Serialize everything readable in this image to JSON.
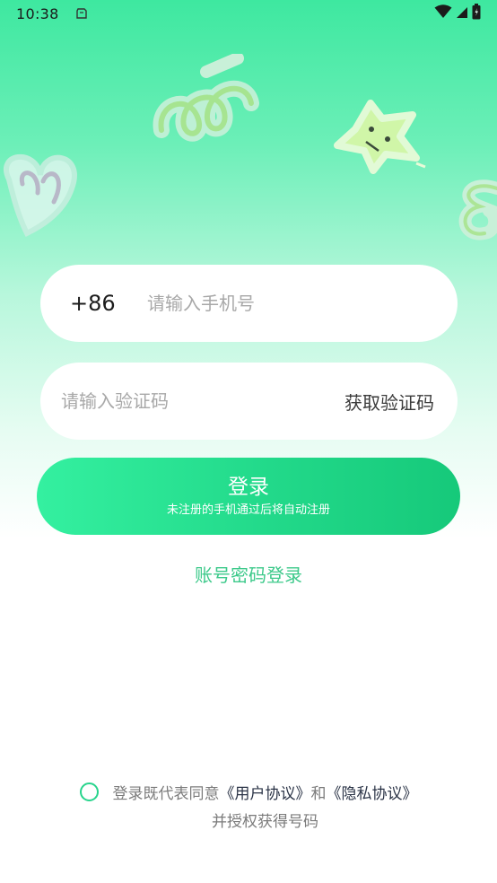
{
  "status_bar": {
    "time": "10:38"
  },
  "phone": {
    "country_code": "+86",
    "placeholder": "请输入手机号"
  },
  "verify": {
    "placeholder": "请输入验证码",
    "get_code_label": "获取验证码"
  },
  "login": {
    "title": "登录",
    "subtitle": "未注册的手机通过后将自动注册"
  },
  "account_login_label": "账号密码登录",
  "agreement": {
    "prefix": "登录既代表同意",
    "user_agreement": "《用户协议》",
    "and": "和",
    "privacy_agreement": "《隐私协议》",
    "line2": "并授权获得号码"
  },
  "colors": {
    "accent": "#22d98a",
    "link_green": "#3cc98a",
    "gradient_top": "#3ee8a0"
  }
}
